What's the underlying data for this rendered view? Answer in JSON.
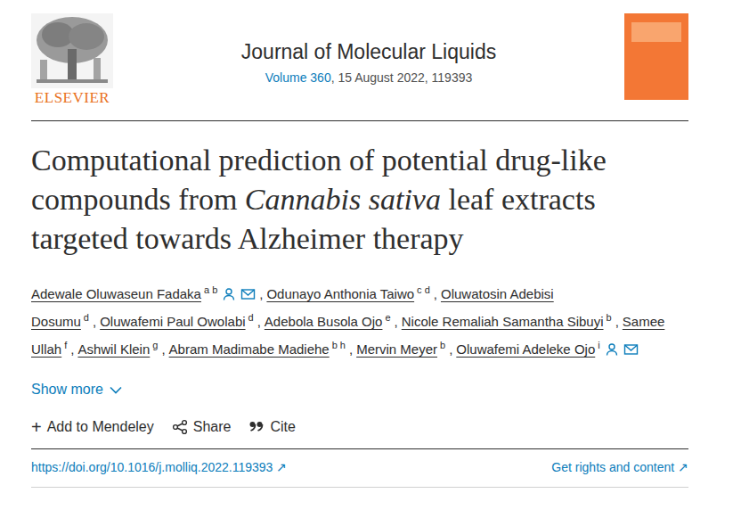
{
  "publisher": {
    "name": "ELSEVIER"
  },
  "journal": {
    "title": "Journal of Molecular Liquids",
    "volume_link": "Volume 360",
    "issue_info": ", 15 August 2022, 119393"
  },
  "article": {
    "title_parts": [
      {
        "text": "Computational prediction of potential drug-like compounds from ",
        "italic": false
      },
      {
        "text": "Cannabis sativa",
        "italic": true
      },
      {
        "text": " leaf extracts targeted towards Alzheimer therapy",
        "italic": false
      }
    ]
  },
  "author_separator": ",",
  "authors": [
    {
      "name": "Adewale Oluwaseun Fadaka",
      "affiliations": "a b",
      "corresponding": true
    },
    {
      "name": "Odunayo Anthonia Taiwo",
      "affiliations": "c d",
      "corresponding": false
    },
    {
      "name": "Oluwatosin Adebisi Dosumu",
      "affiliations": "d",
      "corresponding": false
    },
    {
      "name": "Oluwafemi Paul Owolabi",
      "affiliations": "d",
      "corresponding": false
    },
    {
      "name": "Adebola Busola Ojo",
      "affiliations": "e",
      "corresponding": false
    },
    {
      "name": "Nicole Remaliah Samantha Sibuyi",
      "affiliations": "b",
      "corresponding": false
    },
    {
      "name": "Samee Ullah",
      "affiliations": "f",
      "corresponding": false
    },
    {
      "name": "Ashwil Klein",
      "affiliations": "g",
      "corresponding": false
    },
    {
      "name": "Abram Madimabe Madiehe",
      "affiliations": "b h",
      "corresponding": false
    },
    {
      "name": "Mervin Meyer",
      "affiliations": "b",
      "corresponding": false
    },
    {
      "name": "Oluwafemi Adeleke Ojo",
      "affiliations": "i",
      "corresponding": true
    }
  ],
  "show_more": "Show more",
  "actions": [
    {
      "kind": "mendeley",
      "glyph": "+",
      "label": "Add to Mendeley"
    },
    {
      "kind": "share",
      "glyph": "",
      "label": "Share"
    },
    {
      "kind": "cite",
      "glyph": "",
      "label": "Cite"
    }
  ],
  "links": {
    "doi": "https://doi.org/10.1016/j.molliq.2022.119393",
    "doi_arrow": "↗",
    "rights": "Get rights and content",
    "rights_arrow": "↗"
  }
}
